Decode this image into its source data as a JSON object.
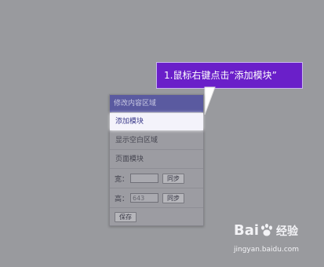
{
  "callout": {
    "text": "1.鼠标右键点击”添加模块”"
  },
  "menu": {
    "header": "修改内容区域",
    "items": [
      "添加模块",
      "显示空白区域",
      "页面模块"
    ],
    "width_row": {
      "label": "宽：",
      "value": "",
      "button": "同步"
    },
    "height_row": {
      "label": "高：",
      "value": "643",
      "button": "同步"
    },
    "save_button": "保存"
  },
  "watermark": {
    "brand_left": "Bai",
    "brand_right": "百",
    "brand_cn": "经验",
    "url": "jingyan.baidu.com"
  },
  "colors": {
    "background": "#999a9e",
    "callout": "#6a1fc9",
    "menu_header": "#5a5aa0",
    "highlight": "#f4f3fb"
  }
}
